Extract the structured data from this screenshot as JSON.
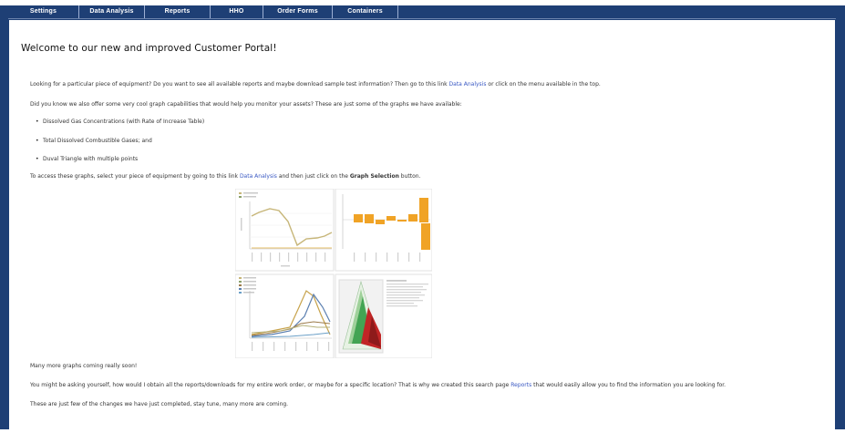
{
  "nav": {
    "items": [
      {
        "label": "Settings"
      },
      {
        "label": "Data Analysis"
      },
      {
        "label": "Reports"
      },
      {
        "label": "HHO"
      },
      {
        "label": "Order Forms"
      },
      {
        "label": "Containers"
      }
    ]
  },
  "main": {
    "title": "Welcome to our new and improved Customer Portal!",
    "intro": {
      "before": "Looking for a particular piece of equipment? Do you want to see all available reports and maybe download sample test information? Then go to this link ",
      "link": "Data Analysis",
      "after": " or click on the menu available in the top."
    },
    "graph_intro": "Did you know we also offer some very cool graph capabilities that would help you monitor your assets? These are just some of the graphs we have available:",
    "bullets": [
      "Dissolved Gas Concentrations (with Rate of Increase Table)",
      "Total Dissolved Combustible Gases; and",
      "Duval Triangle with multiple points"
    ],
    "access": {
      "before": "To access these graphs, select your piece of equipment by going to this link ",
      "link": "Data Analysis",
      "middle": " and then just click on the ",
      "bold": "Graph Selection",
      "after": " button."
    },
    "more_graphs": "Many more graphs coming really soon!",
    "reports": {
      "before": "You might be asking yourself, how would I obtain all the reports/downloads for my entire work order, or maybe for a specific location? That is why we created this search page ",
      "link": "Reports",
      "after": " that would easily allow you to find the information you are looking for."
    },
    "closing": "These are just few of the changes we have just completed, stay tune, many more are coming."
  },
  "colors": {
    "nav_bg": "#1e3f75",
    "link": "#3a59c3",
    "bar_orange": "#f0a326",
    "line_olive": "#c7b679",
    "triangle_green": "#43a453",
    "triangle_red": "#c12626"
  }
}
